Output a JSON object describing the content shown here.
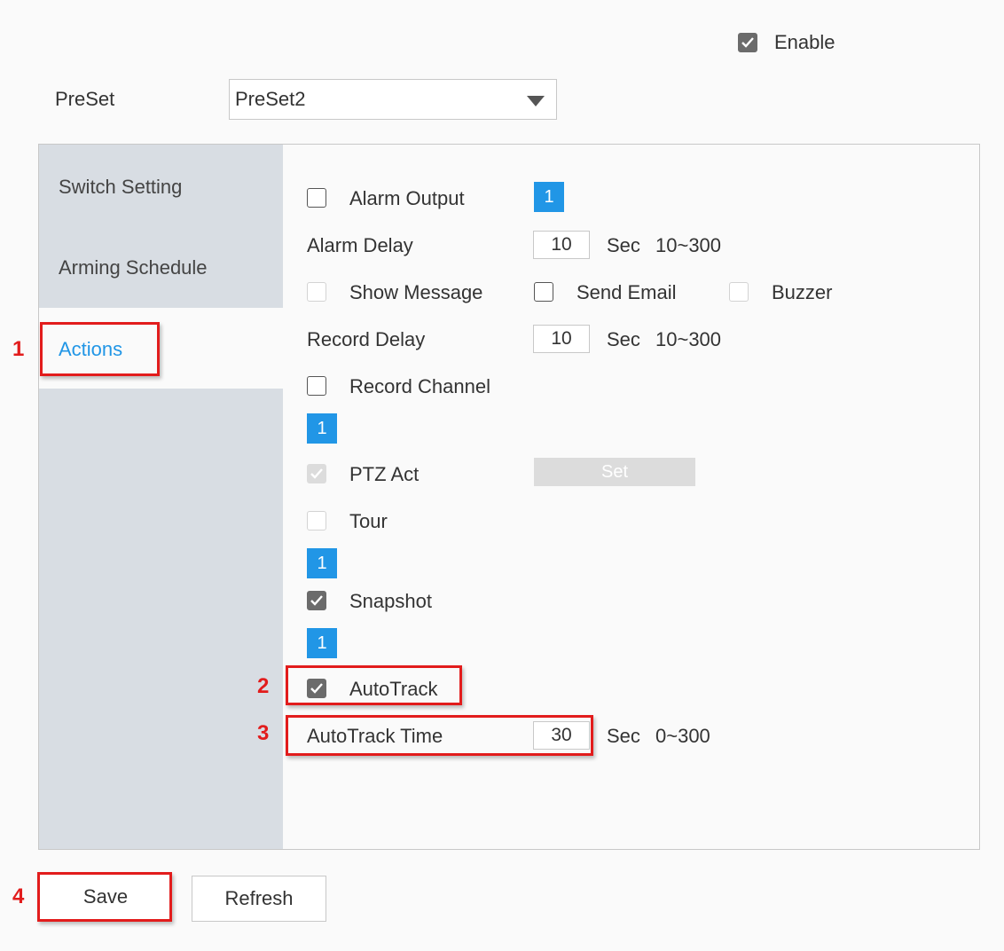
{
  "header": {
    "enable_checked": true,
    "enable_label": "Enable",
    "preset_label": "PreSet",
    "preset_value": "PreSet2"
  },
  "sidebar": {
    "items": [
      {
        "label": "Switch Setting",
        "active": false
      },
      {
        "label": "Arming Schedule",
        "active": false
      },
      {
        "label": "Actions",
        "active": true
      }
    ]
  },
  "actions": {
    "alarm_output_label": "Alarm Output",
    "alarm_output_channel": "1",
    "alarm_delay_label": "Alarm Delay",
    "alarm_delay_value": "10",
    "alarm_delay_unit": "Sec",
    "alarm_delay_range": "10~300",
    "show_message_label": "Show Message",
    "send_email_label": "Send Email",
    "buzzer_label": "Buzzer",
    "record_delay_label": "Record Delay",
    "record_delay_value": "10",
    "record_delay_unit": "Sec",
    "record_delay_range": "10~300",
    "record_channel_label": "Record Channel",
    "record_channel": "1",
    "ptz_act_label": "PTZ Act",
    "ptz_set_label": "Set",
    "tour_label": "Tour",
    "tour_channel": "1",
    "snapshot_label": "Snapshot",
    "snapshot_channel": "1",
    "autotrack_label": "AutoTrack",
    "autotrack_time_label": "AutoTrack Time",
    "autotrack_time_value": "30",
    "autotrack_time_unit": "Sec",
    "autotrack_time_range": "0~300"
  },
  "buttons": {
    "save_label": "Save",
    "refresh_label": "Refresh"
  },
  "annotations": {
    "m1": "1",
    "m2": "2",
    "m3": "3",
    "m4": "4"
  },
  "colors": {
    "accent": "#2196e6",
    "highlight": "#e21c1c",
    "sidebar_bg": "#d8dde3"
  }
}
